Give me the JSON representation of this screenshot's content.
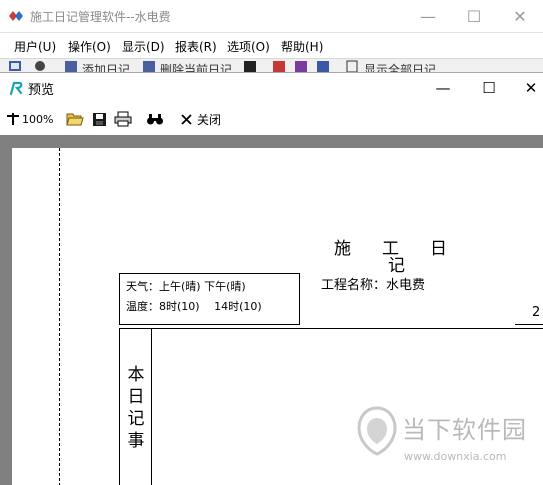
{
  "main_window": {
    "title": "施工日记管理软件--水电费",
    "controls": {
      "minimize": "—",
      "maximize": "☐",
      "close": "✕"
    }
  },
  "menubar": {
    "items": [
      "用户(U)",
      "操作(O)",
      "显示(D)",
      "报表(R)",
      "选项(O)",
      "帮助(H)"
    ]
  },
  "main_toolbar": {
    "add_label": "添加日记",
    "delete_label": "删除当前日记",
    "show_all_label": "显示全部日记"
  },
  "preview_window": {
    "title": "预览",
    "controls": {
      "minimize": "—",
      "maximize": "☐",
      "close": "✕"
    },
    "toolbar": {
      "zoom": "100%",
      "close_label": "关闭",
      "icons": [
        "zoom-icon",
        "open-folder-icon",
        "save-disk-icon",
        "printer-icon",
        "binoculars-icon",
        "close-x-icon"
      ]
    }
  },
  "document": {
    "title_chars": [
      "施",
      "工",
      "日",
      "记"
    ],
    "project_label": "工程名称：",
    "project_name": "水电费",
    "page_number": "2",
    "weather_line": "天气：上午(晴) 下午(晴)",
    "temperature_line": "温度：8时(10)　 14时(10)",
    "diary_label_chars": [
      "本",
      "日",
      "记",
      "事"
    ]
  },
  "watermark": {
    "text": "当下软件园",
    "url": "www.downxia.com"
  },
  "colors": {
    "canvas_bg": "#808080",
    "page_bg": "#ffffff",
    "title_text_inactive": "#8a8a8a",
    "watermark": "#b9b9b9"
  }
}
